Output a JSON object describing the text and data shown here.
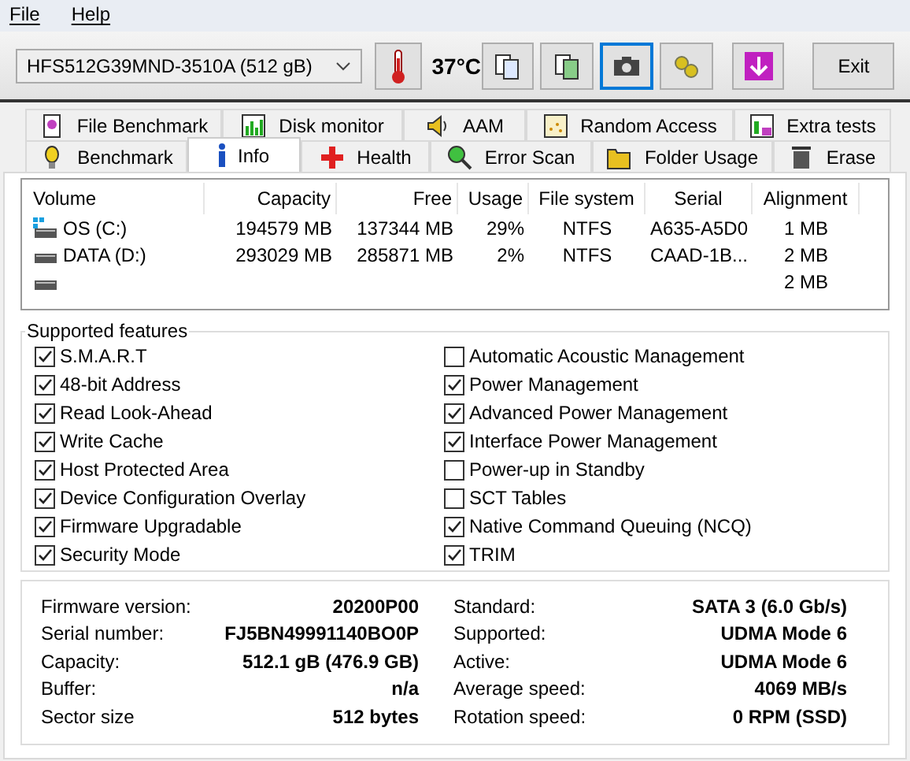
{
  "menu": [
    {
      "label": "File"
    },
    {
      "label": "Help"
    }
  ],
  "toolbar": {
    "drive": "HFS512G39MND-3510A (512 gB)",
    "temperature": "37°C",
    "buttons": [
      {
        "kind": "copy",
        "focused": false
      },
      {
        "kind": "copy-green",
        "focused": false
      },
      {
        "kind": "camera",
        "focused": true
      },
      {
        "kind": "gears",
        "focused": false
      },
      {
        "kind": "download",
        "focused": false
      }
    ],
    "exit": "Exit"
  },
  "tabs_top": [
    {
      "label": "File Benchmark",
      "kind": "file-benchmark",
      "selected": false
    },
    {
      "label": "Disk monitor",
      "kind": "disk-monitor",
      "selected": false
    },
    {
      "label": "AAM",
      "kind": "aam",
      "selected": false
    },
    {
      "label": "Random Access",
      "kind": "random-access",
      "selected": false
    },
    {
      "label": "Extra tests",
      "kind": "extra-tests",
      "selected": false
    }
  ],
  "tabs_bottom": [
    {
      "label": "Benchmark",
      "kind": "benchmark",
      "selected": false
    },
    {
      "label": "Info",
      "kind": "info",
      "selected": true
    },
    {
      "label": "Health",
      "kind": "health",
      "selected": false
    },
    {
      "label": "Error Scan",
      "kind": "error-scan",
      "selected": false
    },
    {
      "label": "Folder Usage",
      "kind": "folder-usage",
      "selected": false
    },
    {
      "label": "Erase",
      "kind": "erase",
      "selected": false
    }
  ],
  "volumes": {
    "columns": [
      "Volume",
      "Capacity",
      "Free",
      "Usage",
      "File system",
      "Serial",
      "Alignment"
    ],
    "rows": [
      {
        "system": true,
        "cells": [
          "OS (C:)",
          "194579 MB",
          "137344 MB",
          "29%",
          "NTFS",
          "A635-A5D0",
          "1 MB"
        ]
      },
      {
        "system": false,
        "cells": [
          "DATA (D:)",
          "293029 MB",
          "285871 MB",
          "2%",
          "NTFS",
          "CAAD-1B...",
          "2 MB"
        ]
      },
      {
        "system": false,
        "cells": [
          "",
          "",
          "",
          "",
          "",
          "",
          "2 MB"
        ]
      }
    ]
  },
  "features": {
    "title": "Supported features",
    "left": [
      {
        "label": "S.M.A.R.T",
        "checked": true
      },
      {
        "label": "48-bit Address",
        "checked": true
      },
      {
        "label": "Read Look-Ahead",
        "checked": true
      },
      {
        "label": "Write Cache",
        "checked": true
      },
      {
        "label": "Host Protected Area",
        "checked": true
      },
      {
        "label": "Device Configuration Overlay",
        "checked": true
      },
      {
        "label": "Firmware Upgradable",
        "checked": true
      },
      {
        "label": "Security Mode",
        "checked": true
      }
    ],
    "right": [
      {
        "label": "Automatic Acoustic Management",
        "checked": false
      },
      {
        "label": "Power Management",
        "checked": true
      },
      {
        "label": "Advanced Power Management",
        "checked": true
      },
      {
        "label": "Interface Power Management",
        "checked": true
      },
      {
        "label": "Power-up in Standby",
        "checked": false
      },
      {
        "label": "SCT Tables",
        "checked": false
      },
      {
        "label": "Native Command Queuing (NCQ)",
        "checked": true
      },
      {
        "label": "TRIM",
        "checked": true
      }
    ]
  },
  "details": {
    "left": [
      {
        "label": "Firmware version:",
        "value": "20200P00"
      },
      {
        "label": "Serial number:",
        "value": "FJ5BN49991140BO0P"
      },
      {
        "label": "Capacity:",
        "value": "512.1 gB (476.9 GB)"
      },
      {
        "label": "Buffer:",
        "value": "n/a"
      },
      {
        "label": "Sector size",
        "value": "512 bytes"
      }
    ],
    "right": [
      {
        "label": "Standard:",
        "value": "SATA 3 (6.0 Gb/s)"
      },
      {
        "label": "Supported:",
        "value": "UDMA Mode 6"
      },
      {
        "label": "Active:",
        "value": "UDMA Mode 6"
      },
      {
        "label": "Average speed:",
        "value": "4069 MB/s"
      },
      {
        "label": "Rotation speed:",
        "value": "0 RPM (SSD)"
      }
    ]
  }
}
